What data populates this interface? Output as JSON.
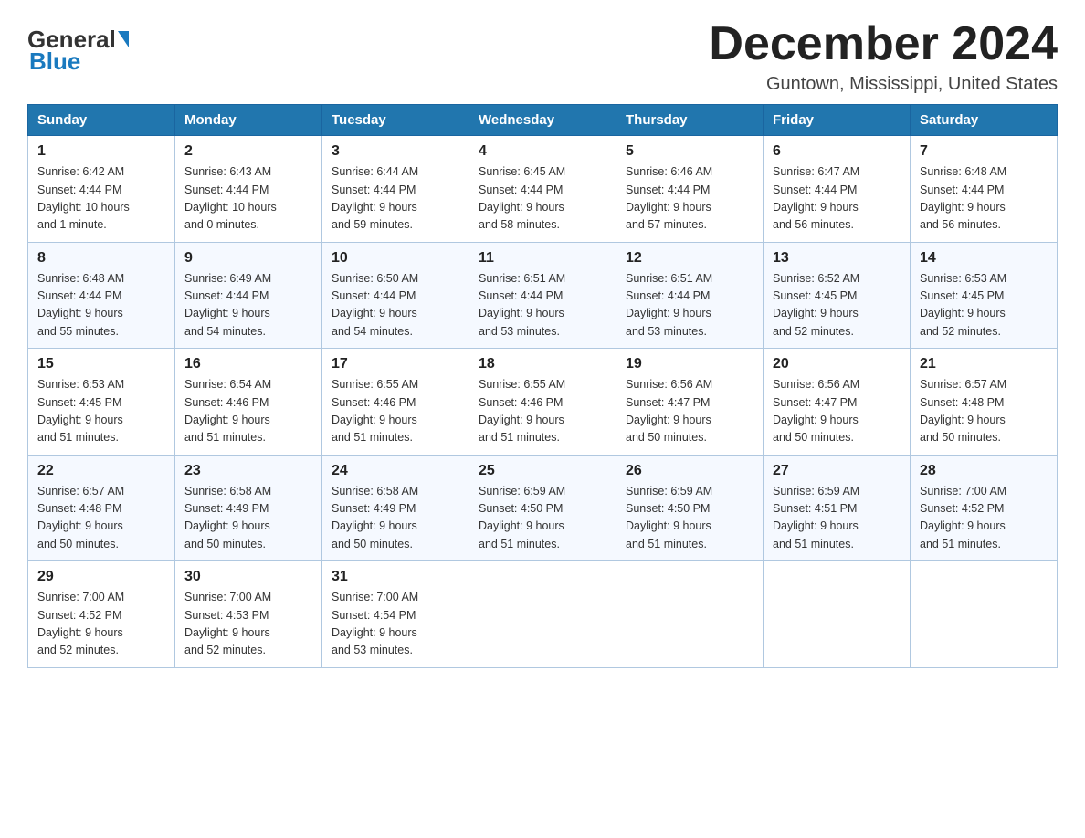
{
  "header": {
    "logo": {
      "general": "General",
      "blue": "Blue",
      "underline": "Blue"
    },
    "title": "December 2024",
    "location": "Guntown, Mississippi, United States"
  },
  "days_of_week": [
    "Sunday",
    "Monday",
    "Tuesday",
    "Wednesday",
    "Thursday",
    "Friday",
    "Saturday"
  ],
  "weeks": [
    [
      {
        "date": "1",
        "sunrise": "6:42 AM",
        "sunset": "4:44 PM",
        "daylight": "10 hours and 1 minute."
      },
      {
        "date": "2",
        "sunrise": "6:43 AM",
        "sunset": "4:44 PM",
        "daylight": "10 hours and 0 minutes."
      },
      {
        "date": "3",
        "sunrise": "6:44 AM",
        "sunset": "4:44 PM",
        "daylight": "9 hours and 59 minutes."
      },
      {
        "date": "4",
        "sunrise": "6:45 AM",
        "sunset": "4:44 PM",
        "daylight": "9 hours and 58 minutes."
      },
      {
        "date": "5",
        "sunrise": "6:46 AM",
        "sunset": "4:44 PM",
        "daylight": "9 hours and 57 minutes."
      },
      {
        "date": "6",
        "sunrise": "6:47 AM",
        "sunset": "4:44 PM",
        "daylight": "9 hours and 56 minutes."
      },
      {
        "date": "7",
        "sunrise": "6:48 AM",
        "sunset": "4:44 PM",
        "daylight": "9 hours and 56 minutes."
      }
    ],
    [
      {
        "date": "8",
        "sunrise": "6:48 AM",
        "sunset": "4:44 PM",
        "daylight": "9 hours and 55 minutes."
      },
      {
        "date": "9",
        "sunrise": "6:49 AM",
        "sunset": "4:44 PM",
        "daylight": "9 hours and 54 minutes."
      },
      {
        "date": "10",
        "sunrise": "6:50 AM",
        "sunset": "4:44 PM",
        "daylight": "9 hours and 54 minutes."
      },
      {
        "date": "11",
        "sunrise": "6:51 AM",
        "sunset": "4:44 PM",
        "daylight": "9 hours and 53 minutes."
      },
      {
        "date": "12",
        "sunrise": "6:51 AM",
        "sunset": "4:44 PM",
        "daylight": "9 hours and 53 minutes."
      },
      {
        "date": "13",
        "sunrise": "6:52 AM",
        "sunset": "4:45 PM",
        "daylight": "9 hours and 52 minutes."
      },
      {
        "date": "14",
        "sunrise": "6:53 AM",
        "sunset": "4:45 PM",
        "daylight": "9 hours and 52 minutes."
      }
    ],
    [
      {
        "date": "15",
        "sunrise": "6:53 AM",
        "sunset": "4:45 PM",
        "daylight": "9 hours and 51 minutes."
      },
      {
        "date": "16",
        "sunrise": "6:54 AM",
        "sunset": "4:46 PM",
        "daylight": "9 hours and 51 minutes."
      },
      {
        "date": "17",
        "sunrise": "6:55 AM",
        "sunset": "4:46 PM",
        "daylight": "9 hours and 51 minutes."
      },
      {
        "date": "18",
        "sunrise": "6:55 AM",
        "sunset": "4:46 PM",
        "daylight": "9 hours and 51 minutes."
      },
      {
        "date": "19",
        "sunrise": "6:56 AM",
        "sunset": "4:47 PM",
        "daylight": "9 hours and 50 minutes."
      },
      {
        "date": "20",
        "sunrise": "6:56 AM",
        "sunset": "4:47 PM",
        "daylight": "9 hours and 50 minutes."
      },
      {
        "date": "21",
        "sunrise": "6:57 AM",
        "sunset": "4:48 PM",
        "daylight": "9 hours and 50 minutes."
      }
    ],
    [
      {
        "date": "22",
        "sunrise": "6:57 AM",
        "sunset": "4:48 PM",
        "daylight": "9 hours and 50 minutes."
      },
      {
        "date": "23",
        "sunrise": "6:58 AM",
        "sunset": "4:49 PM",
        "daylight": "9 hours and 50 minutes."
      },
      {
        "date": "24",
        "sunrise": "6:58 AM",
        "sunset": "4:49 PM",
        "daylight": "9 hours and 50 minutes."
      },
      {
        "date": "25",
        "sunrise": "6:59 AM",
        "sunset": "4:50 PM",
        "daylight": "9 hours and 51 minutes."
      },
      {
        "date": "26",
        "sunrise": "6:59 AM",
        "sunset": "4:50 PM",
        "daylight": "9 hours and 51 minutes."
      },
      {
        "date": "27",
        "sunrise": "6:59 AM",
        "sunset": "4:51 PM",
        "daylight": "9 hours and 51 minutes."
      },
      {
        "date": "28",
        "sunrise": "7:00 AM",
        "sunset": "4:52 PM",
        "daylight": "9 hours and 51 minutes."
      }
    ],
    [
      {
        "date": "29",
        "sunrise": "7:00 AM",
        "sunset": "4:52 PM",
        "daylight": "9 hours and 52 minutes."
      },
      {
        "date": "30",
        "sunrise": "7:00 AM",
        "sunset": "4:53 PM",
        "daylight": "9 hours and 52 minutes."
      },
      {
        "date": "31",
        "sunrise": "7:00 AM",
        "sunset": "4:54 PM",
        "daylight": "9 hours and 53 minutes."
      },
      null,
      null,
      null,
      null
    ]
  ],
  "labels": {
    "sunrise": "Sunrise:",
    "sunset": "Sunset:",
    "daylight": "Daylight:"
  }
}
